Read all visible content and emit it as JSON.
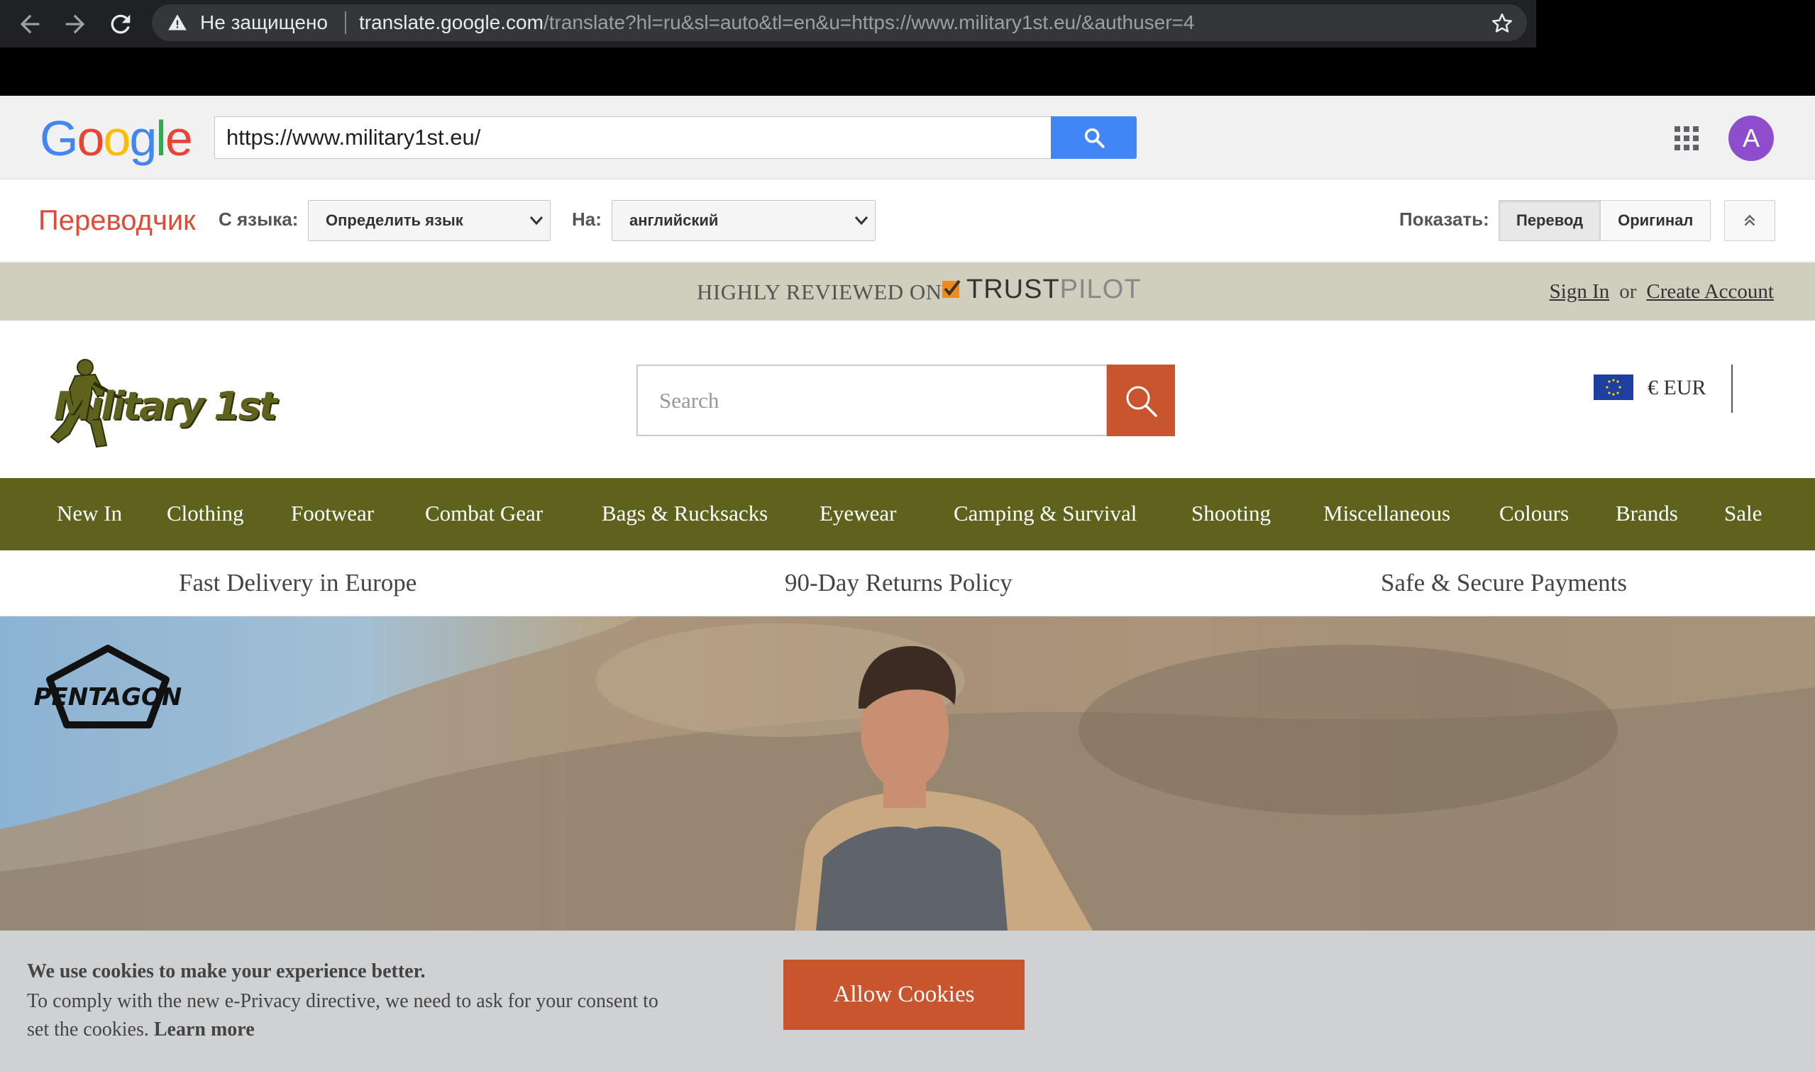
{
  "browser": {
    "insecure_label": "Не защищено",
    "url_host": "translate.google.com",
    "url_rest": "/translate?hl=ru&sl=auto&tl=en&u=https://www.military1st.eu/&authuser=4",
    "icons": [
      "back-icon",
      "forward-icon",
      "reload-icon",
      "warning-icon",
      "star-icon"
    ]
  },
  "google_bar": {
    "logo_letters": [
      "G",
      "o",
      "o",
      "g",
      "l",
      "e"
    ],
    "logo_colors": [
      "#4285f4",
      "#ea4335",
      "#fbbc05",
      "#4285f4",
      "#34a853",
      "#ea4335"
    ],
    "url_input_value": "https://www.military1st.eu/",
    "avatar_letter": "A",
    "avatar_color": "#8d4dcc"
  },
  "translate_bar": {
    "brand": "Переводчик",
    "from_label": "С языка:",
    "from_value": "Определить язык",
    "to_label": "На:",
    "to_value": "английский",
    "show_label": "Показать:",
    "translation_button": "Перевод",
    "original_button": "Оригинал"
  },
  "site": {
    "trust_text": "HIGHLY REVIEWED ON",
    "trust_brand_a": "TRUST",
    "trust_brand_b": "PILOT",
    "sign_in": "Sign In",
    "or": "or",
    "create_account": "Create Account",
    "logo_text": "Military 1st",
    "search_placeholder": "Search",
    "currency": "€ EUR",
    "nav": [
      "New In",
      "Clothing",
      "Footwear",
      "Combat Gear",
      "Bags & Rucksacks",
      "Eyewear",
      "Camping & Survival",
      "Shooting",
      "Miscellaneous",
      "Colours",
      "Brands",
      "Sale"
    ],
    "usps": [
      "Fast Delivery in Europe",
      "90-Day Returns Policy",
      "Safe & Secure Payments"
    ],
    "hero_brand": "PENTAGON",
    "accent_color": "#c8552e",
    "nav_color": "#5e621c"
  },
  "cookie": {
    "title": "We use cookies to make your experience better.",
    "text": "To comply with the new e-Privacy directive, we need to ask for your consent to set the cookies.",
    "learn_more": "Learn more",
    "button": "Allow Cookies"
  }
}
